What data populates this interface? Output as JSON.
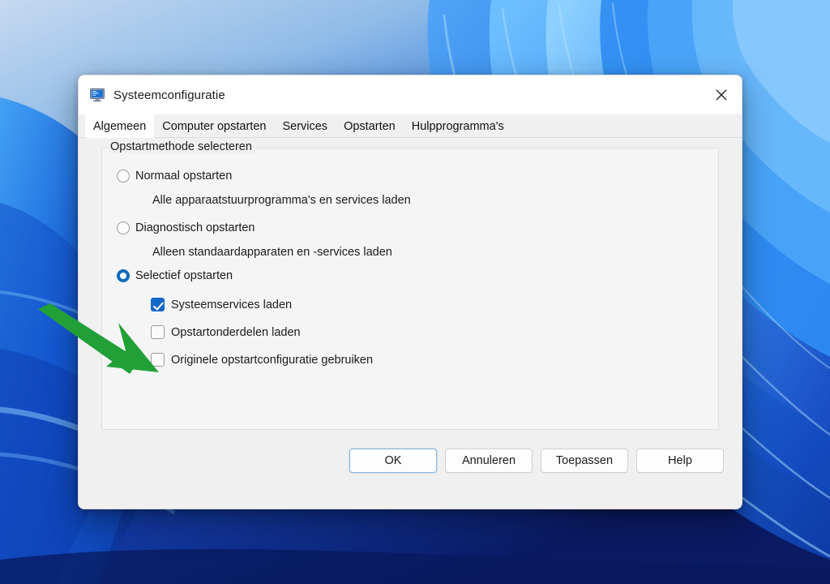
{
  "window": {
    "title": "Systeemconfiguratie",
    "icon": "system-configuration-icon",
    "close_label": "✕"
  },
  "tabs": [
    {
      "label": "Algemeen",
      "active": true
    },
    {
      "label": "Computer opstarten",
      "active": false
    },
    {
      "label": "Services",
      "active": false
    },
    {
      "label": "Opstarten",
      "active": false
    },
    {
      "label": "Hulpprogramma's",
      "active": false
    }
  ],
  "groupbox": {
    "legend": "Opstartmethode selecteren",
    "options": [
      {
        "label": "Normaal opstarten",
        "checked": false,
        "description": "Alle apparaatstuurprogramma's en services laden"
      },
      {
        "label": "Diagnostisch opstarten",
        "checked": false,
        "description": "Alleen standaardapparaten en -services laden"
      },
      {
        "label": "Selectief opstarten",
        "checked": true,
        "description": ""
      }
    ],
    "checkboxes": [
      {
        "label": "Systeemservices laden",
        "checked": true
      },
      {
        "label": "Opstartonderdelen laden",
        "checked": false
      },
      {
        "label": "Originele opstartconfiguratie gebruiken",
        "checked": false
      }
    ]
  },
  "buttons": [
    {
      "label": "OK",
      "default": true
    },
    {
      "label": "Annuleren",
      "default": false
    },
    {
      "label": "Toepassen",
      "default": false
    },
    {
      "label": "Help",
      "default": false
    }
  ],
  "annotation": {
    "type": "arrow",
    "color": "#21a038",
    "points_to": "Originele opstartconfiguratie gebruiken"
  },
  "colors": {
    "accent": "#1668c7",
    "radio_accent": "#0f6cbd",
    "arrow_green": "#21a038",
    "dialog_bg": "#f0f0f0",
    "titlebar_bg": "#ffffff"
  }
}
